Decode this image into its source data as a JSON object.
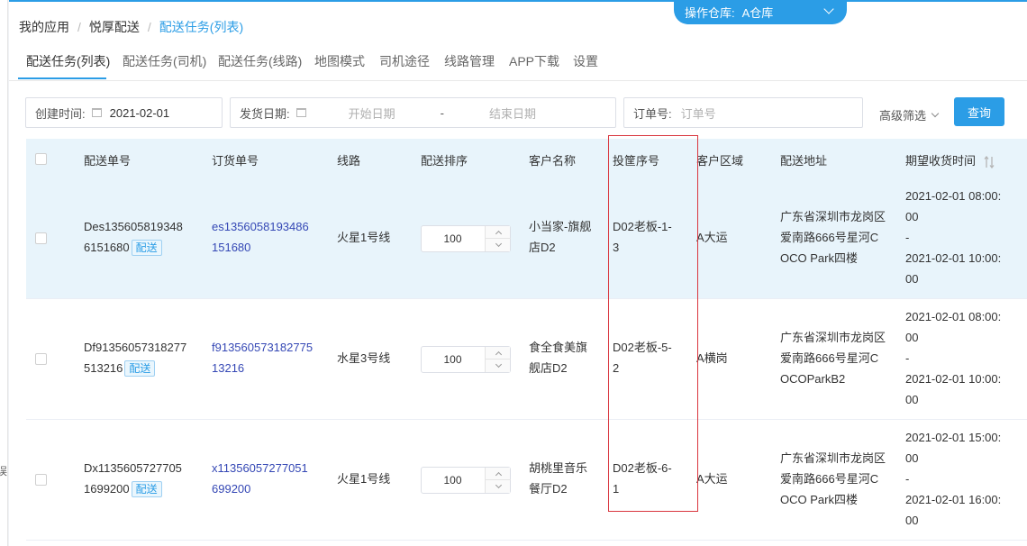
{
  "breadcrumb": [
    "我的应用",
    "悦厚配送",
    "配送任务(列表)"
  ],
  "warehouse": {
    "label": "操作仓库:",
    "value": "A仓库"
  },
  "tabs": [
    "配送任务(列表)",
    "配送任务(司机)",
    "配送任务(线路)",
    "地图模式",
    "司机途径",
    "线路管理",
    "APP下载",
    "设置"
  ],
  "filters": {
    "create_time_label": "创建时间:",
    "create_time_value": "2021-02-01",
    "ship_date_label": "发货日期:",
    "start_placeholder": "开始日期",
    "dash": "-",
    "end_placeholder": "结束日期",
    "order_no_label": "订单号:",
    "order_no_placeholder": "订单号",
    "advanced": "高级筛选",
    "query_button": "查询"
  },
  "table": {
    "headers": [
      "配送单号",
      "订货单号",
      "线路",
      "配送排序",
      "客户名称",
      "投筐序号",
      "客户区域",
      "配送地址",
      "期望收货时间"
    ],
    "rows": [
      {
        "delivery_no": [
          "Des135605819348",
          "6151680"
        ],
        "tag": "配送",
        "order_no": [
          "es1356058193486",
          "151680"
        ],
        "route": "火星1号线",
        "sort": "100",
        "customer": [
          "小当家-旗舰",
          "店D2"
        ],
        "basket": [
          "D02老板-1-",
          "3"
        ],
        "region": "A大运",
        "address": [
          "广东省深圳市龙岗区",
          "爱南路666号星河C",
          "OCO Park四楼"
        ],
        "time": [
          "2021-02-01 08:00:",
          "00",
          "-",
          "2021-02-01 10:00:",
          "00"
        ]
      },
      {
        "delivery_no": [
          "Df91356057318277",
          "513216"
        ],
        "tag": "配送",
        "order_no": [
          "f913560573182775",
          "13216"
        ],
        "route": "水星3号线",
        "sort": "100",
        "customer": [
          "食全食美旗",
          "舰店D2"
        ],
        "basket": [
          "D02老板-5-",
          "2"
        ],
        "region": "A横岗",
        "address": [
          "广东省深圳市龙岗区",
          "爱南路666号星河C",
          "OCOParkB2"
        ],
        "time": [
          "2021-02-01 08:00:",
          "00",
          "-",
          "2021-02-01 10:00:",
          "00"
        ]
      },
      {
        "delivery_no": [
          "Dx1135605727705",
          "1699200"
        ],
        "tag": "配送",
        "order_no": [
          "x11356057277051",
          "699200"
        ],
        "route": "火星1号线",
        "sort": "100",
        "customer": [
          "胡桃里音乐",
          "餐厅D2"
        ],
        "basket": [
          "D02老板-6-",
          "1"
        ],
        "region": "A大运",
        "address": [
          "广东省深圳市龙岗区",
          "爱南路666号星河C",
          "OCO Park四楼"
        ],
        "time": [
          "2021-02-01 15:00:",
          "00",
          "-",
          "2021-02-01 16:00:",
          "00"
        ]
      }
    ]
  },
  "colors": {
    "accent": "#2b9de6",
    "highlight": "#d9363e",
    "link": "#3548b5"
  },
  "sidebar_glyph": "误"
}
